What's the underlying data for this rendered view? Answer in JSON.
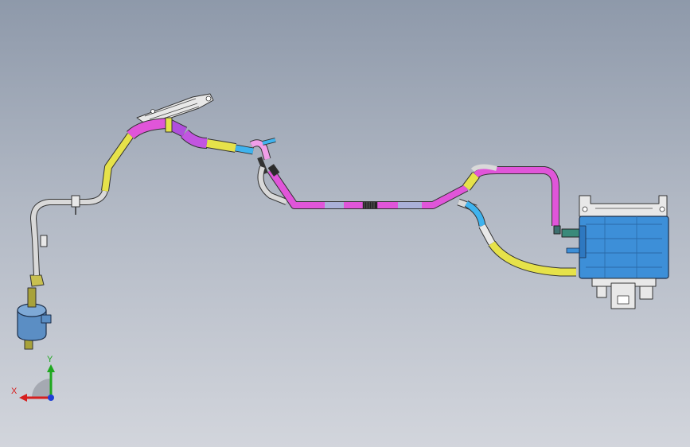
{
  "viewport": {
    "background_top": "#8e99aa",
    "background_bottom": "#d2d5dc"
  },
  "colors": {
    "yellow_pipe": "#e6e24a",
    "magenta_pipe": "#e055d9",
    "purple_pipe": "#b04fdc",
    "pink_pipe": "#f09ee8",
    "grey_pipe": "#d9d9d9",
    "blue_pipe": "#3fb3ee",
    "lavender_segment": "#aab0d8",
    "canister_blue": "#3d8fd8",
    "filter_blue": "#5b8ec4",
    "olive_pipe": "#a8a23a",
    "bracket": "#e8e8e8",
    "outline": "#333333"
  },
  "triad": {
    "x_label": "X",
    "y_label": "Y",
    "x_color": "#d61f1f",
    "y_color": "#1fa81f",
    "z_color": "#1f3fd6"
  }
}
